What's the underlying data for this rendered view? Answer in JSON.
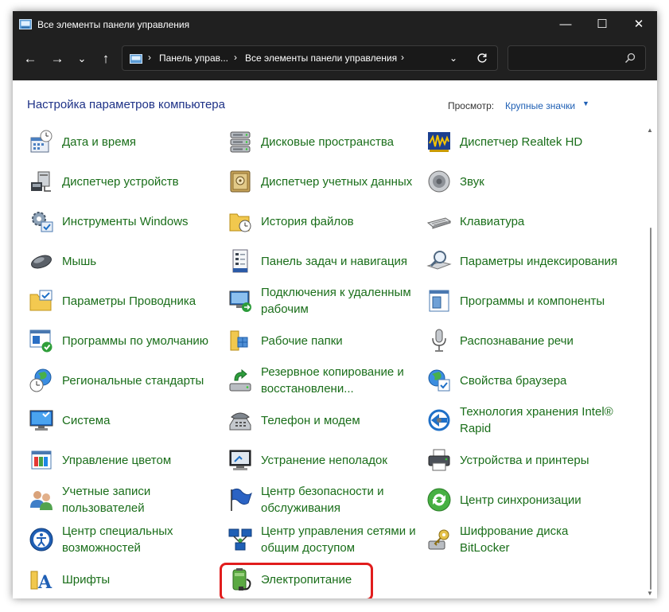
{
  "window": {
    "title": "Все элементы панели управления",
    "controls": {
      "minimize": "—",
      "maximize": "☐",
      "close": "✕"
    }
  },
  "nav": {
    "back": "←",
    "forward": "→",
    "recent": "⌄",
    "up": "↑"
  },
  "address": {
    "crumbs": [
      "Панель управ...",
      "Все элементы панели управления"
    ],
    "separator": "›"
  },
  "search": {
    "placeholder": "",
    "value": ""
  },
  "header": {
    "title": "Настройка параметров компьютера",
    "view_label": "Просмотр:",
    "view_value": "Крупные значки"
  },
  "items": {
    "date_time": "Дата и время",
    "storage_spaces": "Дисковые пространства",
    "realtek": "Диспетчер Realtek HD",
    "device_manager": "Диспетчер устройств",
    "credential_manager": "Диспетчер учетных данных",
    "sound": "Звук",
    "windows_tools": "Инструменты Windows",
    "file_history": "История файлов",
    "keyboard": "Клавиатура",
    "mouse": "Мышь",
    "taskbar": "Панель задач и навигация",
    "indexing": "Параметры индексирования",
    "explorer_options": "Параметры Проводника",
    "remote_app": "Подключения к удаленным рабочим",
    "programs_features": "Программы и компоненты",
    "default_programs": "Программы по умолчанию",
    "work_folders": "Рабочие папки",
    "speech": "Распознавание речи",
    "region": "Региональные стандарты",
    "backup": "Резервное копирование и восстановлени...",
    "internet_options": "Свойства браузера",
    "system": "Система",
    "phone_modem": "Телефон и модем",
    "intel_rst": "Технология хранения Intel® Rapid",
    "color_management": "Управление цветом",
    "troubleshooting": "Устранение неполадок",
    "devices_printers": "Устройства и принтеры",
    "user_accounts": "Учетные записи пользователей",
    "security_maintenance": "Центр безопасности и обслуживания",
    "sync_center": "Центр синхронизации",
    "ease_of_access": "Центр специальных возможностей",
    "network_sharing": "Центр управления сетями и общим доступом",
    "bitlocker": "Шифрование диска BitLocker",
    "fonts": "Шрифты",
    "power_options": "Электропитание"
  },
  "colors": {
    "titlebar": "#202020",
    "item_text": "#1a6e1a",
    "heading": "#1e3287",
    "link": "#1e5fb4",
    "highlight_border": "#e11d1d"
  }
}
